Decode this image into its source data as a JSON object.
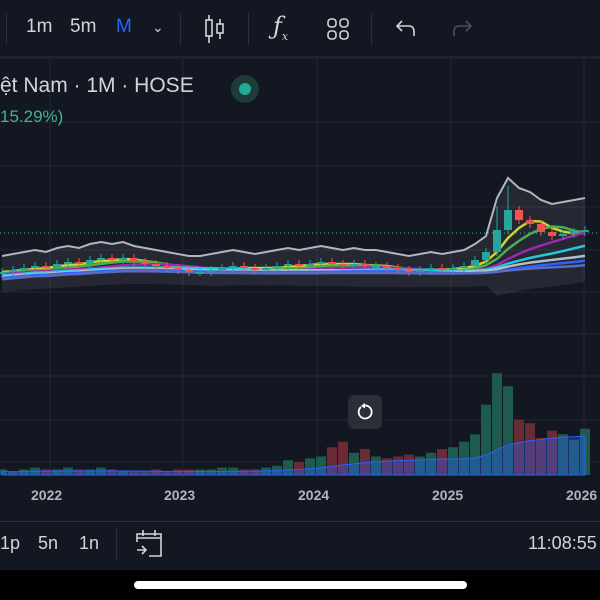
{
  "toolbar": {
    "intervals": [
      "1m",
      "5m",
      "M"
    ],
    "active_interval": "M",
    "accent": "#2962ff"
  },
  "legend": {
    "title": "ệt Nam · 1M · HOSE",
    "change": "15.29%)"
  },
  "x_axis": {
    "years": [
      "2022",
      "2023",
      "2024",
      "2025",
      "2026"
    ]
  },
  "bottom": {
    "ranges": [
      "1p",
      "5n",
      "1n"
    ],
    "time": "11:08:55"
  },
  "colors": {
    "up": "#26a69a",
    "down": "#ef5350",
    "up_vol": "#1f5a4f",
    "down_vol": "#6b2b34"
  },
  "chart_data": {
    "type": "candlestick",
    "start": "2021-08",
    "closes": [
      24,
      25,
      26,
      27,
      26,
      28,
      29,
      28,
      30,
      31,
      30,
      31,
      29,
      28,
      27,
      26,
      25,
      24,
      24,
      25,
      26,
      27,
      26,
      25,
      26,
      27,
      28,
      27,
      28,
      29,
      28,
      27,
      28,
      27,
      27,
      26,
      25,
      24,
      25,
      26,
      25,
      26,
      27,
      30,
      34,
      45,
      55,
      50,
      48,
      44,
      42,
      43,
      44,
      45
    ],
    "volumes": [
      3,
      2,
      3,
      4,
      3,
      3,
      4,
      3,
      3,
      4,
      3,
      2,
      2,
      2,
      3,
      2,
      3,
      3,
      3,
      3,
      4,
      4,
      3,
      3,
      4,
      5,
      8,
      7,
      9,
      10,
      15,
      18,
      12,
      14,
      10,
      9,
      10,
      11,
      10,
      12,
      14,
      15,
      18,
      22,
      38,
      55,
      48,
      30,
      28,
      20,
      24,
      22,
      19,
      25
    ]
  }
}
